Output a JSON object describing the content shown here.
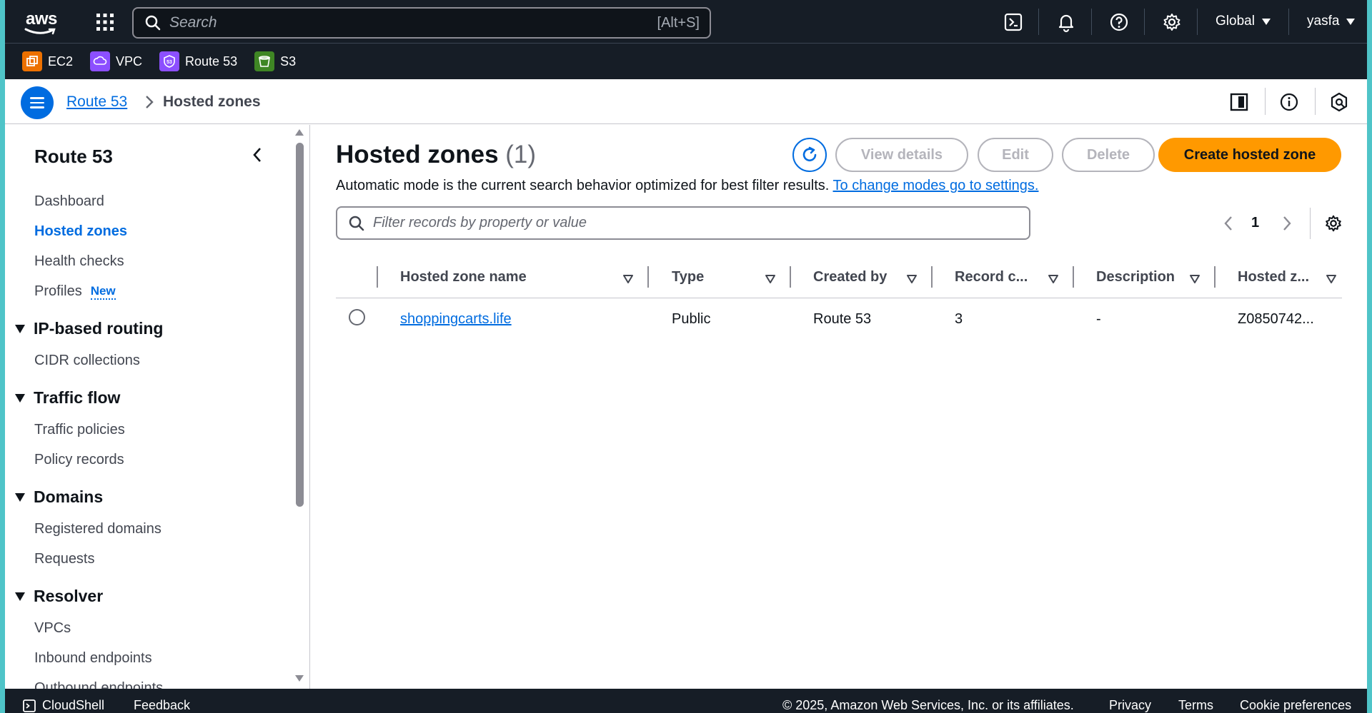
{
  "topnav": {
    "logo_text": "aws",
    "search_placeholder": "Search",
    "search_shortcut": "[Alt+S]",
    "region": "Global",
    "user": "yasfa"
  },
  "favorites": [
    {
      "label": "EC2",
      "color": "#ed7100"
    },
    {
      "label": "VPC",
      "color": "#8c4fff"
    },
    {
      "label": "Route 53",
      "color": "#8c4fff"
    },
    {
      "label": "S3",
      "color": "#3f8624"
    }
  ],
  "breadcrumb": {
    "parent": "Route 53",
    "current": "Hosted zones"
  },
  "sidebar": {
    "title": "Route 53",
    "items": [
      {
        "label": "Dashboard"
      },
      {
        "label": "Hosted zones"
      },
      {
        "label": "Health checks"
      },
      {
        "label": "Profiles",
        "badge": "New"
      }
    ],
    "sections": [
      {
        "title": "IP-based routing",
        "items": [
          "CIDR collections"
        ]
      },
      {
        "title": "Traffic flow",
        "items": [
          "Traffic policies",
          "Policy records"
        ]
      },
      {
        "title": "Domains",
        "items": [
          "Registered domains",
          "Requests"
        ]
      },
      {
        "title": "Resolver",
        "items": [
          "VPCs",
          "Inbound endpoints",
          "Outbound endpoints"
        ]
      }
    ]
  },
  "main": {
    "title": "Hosted zones",
    "count": "(1)",
    "buttons": {
      "view_details": "View details",
      "edit": "Edit",
      "delete": "Delete",
      "create": "Create hosted zone"
    },
    "description": "Automatic mode is the current search behavior optimized for best filter results.",
    "description_link": "To change modes go to settings.",
    "filter_placeholder": "Filter records by property or value",
    "page": "1",
    "columns": [
      "Hosted zone name",
      "Type",
      "Created by",
      "Record c...",
      "Description",
      "Hosted z..."
    ],
    "rows": [
      {
        "name": "shoppingcarts.life",
        "type": "Public",
        "created_by": "Route 53",
        "record_count": "3",
        "description": "-",
        "hosted_zone_id": "Z0850742..."
      }
    ]
  },
  "footer": {
    "cloudshell": "CloudShell",
    "feedback": "Feedback",
    "copyright": "© 2025, Amazon Web Services, Inc. or its affiliates.",
    "privacy": "Privacy",
    "terms": "Terms",
    "cookies": "Cookie preferences"
  },
  "colors": {
    "accent": "#006ce0",
    "primary_button": "#ff9900",
    "nav_bg": "#161d26"
  }
}
